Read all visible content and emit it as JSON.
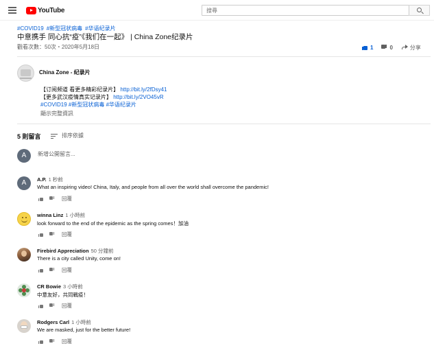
{
  "header": {
    "logo_text": "YouTube",
    "search_placeholder": "搜尋"
  },
  "video": {
    "tags": [
      "#COVID19",
      "#新型冠状病毒",
      "#华语纪录片"
    ],
    "title": "中意携手 同心抗“疫”《我们在一起》 | China Zone纪录片",
    "meta": "觀看次數：50次・2020年5月18日",
    "likes": "1",
    "dislikes": "0",
    "share_label": "分享"
  },
  "channel": {
    "name": "China Zone - 纪录片",
    "desc_line1_text": "【订阅频道 看更多精彩纪录片】",
    "desc_line1_link": "http://bit.ly/2fDsy41",
    "desc_line2_text": "【更多武汉疫情真实记录片】",
    "desc_line2_link": "http://bit.ly/2VO45vR",
    "desc_tags": "#COVID19 #新型冠状病毒 #华语纪录片",
    "show_more": "顯示完整資訊"
  },
  "comments_section": {
    "count_label": "5 則留言",
    "sort_label": "排序依據",
    "add_placeholder": "新增公開留言...",
    "user_initial": "A",
    "reply_label": "回覆"
  },
  "comments": [
    {
      "author": "A.P.",
      "time": "1 秒前",
      "text": "What an inspiring video! China, Italy, and people from all over the world shall overcome the pandemic!",
      "avatar": "letter-avatar",
      "initial": "A"
    },
    {
      "author": "winna Linz",
      "time": "1 小時前",
      "text": "look forward to the end of the epidemic as the spring comes！加油",
      "avatar": "smiley-avatar"
    },
    {
      "author": "Firebird Appreciation",
      "time": "50 分鐘前",
      "text": "There is a city called Unity, come on!",
      "avatar": "photo-avatar"
    },
    {
      "author": "CR Bowie",
      "time": "3 小時前",
      "text": "中意友好，共同戰疫！",
      "avatar": "flower-avatar"
    },
    {
      "author": "Rodgers Carl",
      "time": "1 小時前",
      "text": "We are masked, just for the better future!",
      "avatar": "masked-avatar"
    }
  ],
  "colors": {
    "link_blue": "#065fd4",
    "brand_red": "#ff0000",
    "muted_text": "#606060"
  }
}
